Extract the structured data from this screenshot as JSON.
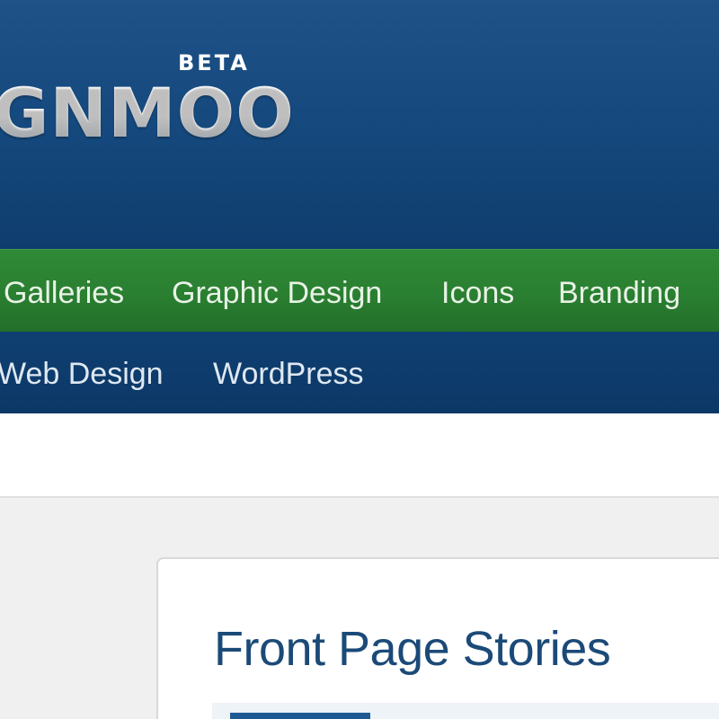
{
  "header": {
    "badge": "BETA",
    "logo_text": "GNMOO"
  },
  "nav_primary": {
    "items": [
      {
        "label": "Galleries"
      },
      {
        "label": "Graphic Design"
      },
      {
        "label": "Icons"
      },
      {
        "label": "Branding"
      }
    ]
  },
  "nav_secondary": {
    "items": [
      {
        "label": "Web Design"
      },
      {
        "label": "WordPress"
      }
    ]
  },
  "main": {
    "section_title": "Front Page Stories"
  },
  "colors": {
    "header_blue": "#164a7f",
    "nav_green": "#2a7f31",
    "nav_dark_blue": "#0f3f72",
    "title_blue": "#1b4a78",
    "content_gray": "#f0f0f0"
  }
}
